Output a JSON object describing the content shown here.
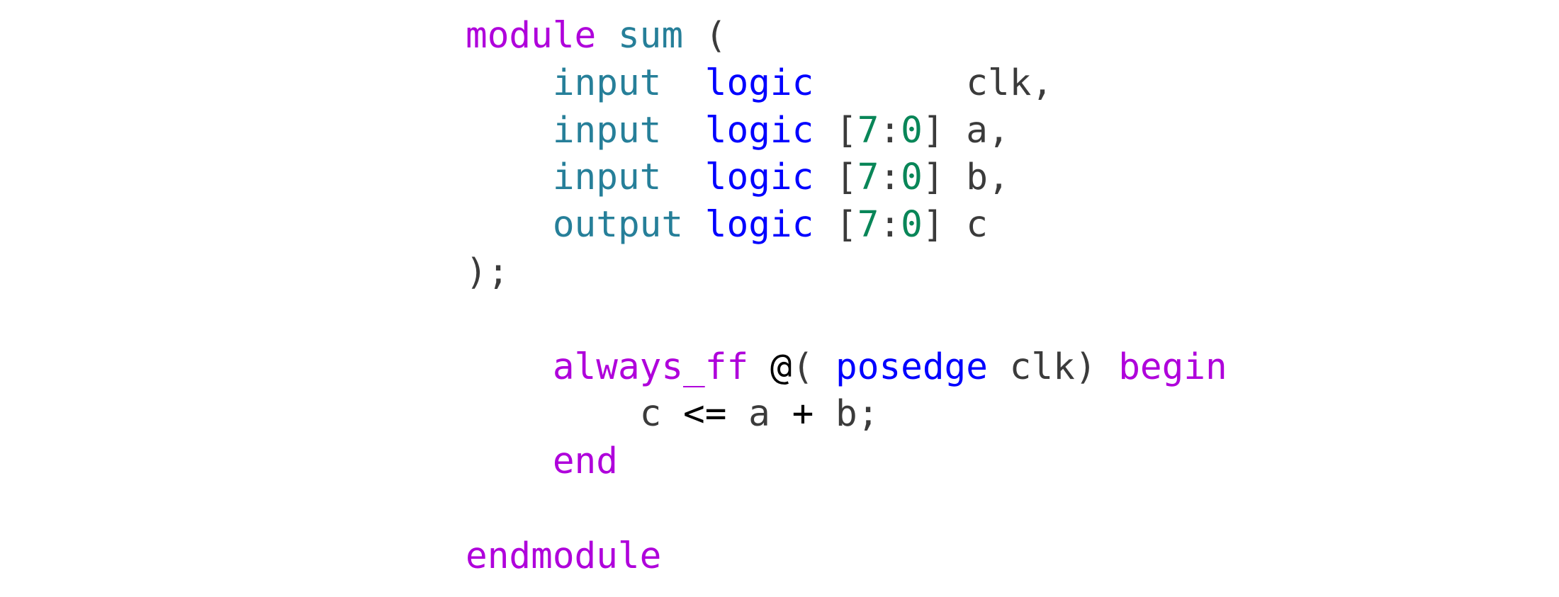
{
  "colors": {
    "background": "#ffffff",
    "control_keyword": "#af00db",
    "type_keyword": "#0000ff",
    "port_direction_and_module_name": "#267f99",
    "number": "#098658",
    "default_text": "#3b3b3b",
    "operator": "#000000"
  },
  "code": {
    "lines": [
      {
        "tokens": [
          {
            "text": "module",
            "kind": "control_keyword"
          },
          {
            "text": " ",
            "kind": "plain"
          },
          {
            "text": "sum",
            "kind": "module_name"
          },
          {
            "text": " (",
            "kind": "plain"
          }
        ]
      },
      {
        "tokens": [
          {
            "text": "    ",
            "kind": "plain"
          },
          {
            "text": "input",
            "kind": "port_direction"
          },
          {
            "text": "  ",
            "kind": "plain"
          },
          {
            "text": "logic",
            "kind": "type_keyword"
          },
          {
            "text": "       clk,",
            "kind": "plain"
          }
        ]
      },
      {
        "tokens": [
          {
            "text": "    ",
            "kind": "plain"
          },
          {
            "text": "input",
            "kind": "port_direction"
          },
          {
            "text": "  ",
            "kind": "plain"
          },
          {
            "text": "logic",
            "kind": "type_keyword"
          },
          {
            "text": " [",
            "kind": "plain"
          },
          {
            "text": "7",
            "kind": "number"
          },
          {
            "text": ":",
            "kind": "plain"
          },
          {
            "text": "0",
            "kind": "number"
          },
          {
            "text": "] a,",
            "kind": "plain"
          }
        ]
      },
      {
        "tokens": [
          {
            "text": "    ",
            "kind": "plain"
          },
          {
            "text": "input",
            "kind": "port_direction"
          },
          {
            "text": "  ",
            "kind": "plain"
          },
          {
            "text": "logic",
            "kind": "type_keyword"
          },
          {
            "text": " [",
            "kind": "plain"
          },
          {
            "text": "7",
            "kind": "number"
          },
          {
            "text": ":",
            "kind": "plain"
          },
          {
            "text": "0",
            "kind": "number"
          },
          {
            "text": "] b,",
            "kind": "plain"
          }
        ]
      },
      {
        "tokens": [
          {
            "text": "    ",
            "kind": "plain"
          },
          {
            "text": "output",
            "kind": "port_direction"
          },
          {
            "text": " ",
            "kind": "plain"
          },
          {
            "text": "logic",
            "kind": "type_keyword"
          },
          {
            "text": " [",
            "kind": "plain"
          },
          {
            "text": "7",
            "kind": "number"
          },
          {
            "text": ":",
            "kind": "plain"
          },
          {
            "text": "0",
            "kind": "number"
          },
          {
            "text": "] c",
            "kind": "plain"
          }
        ]
      },
      {
        "tokens": [
          {
            "text": ");",
            "kind": "plain"
          }
        ]
      },
      {
        "tokens": []
      },
      {
        "tokens": [
          {
            "text": "    ",
            "kind": "plain"
          },
          {
            "text": "always_ff",
            "kind": "control_keyword"
          },
          {
            "text": " ",
            "kind": "plain"
          },
          {
            "text": "@",
            "kind": "operator"
          },
          {
            "text": "( ",
            "kind": "plain"
          },
          {
            "text": "posedge",
            "kind": "type_keyword"
          },
          {
            "text": " clk) ",
            "kind": "plain"
          },
          {
            "text": "begin",
            "kind": "control_keyword"
          }
        ]
      },
      {
        "tokens": [
          {
            "text": "        c ",
            "kind": "plain"
          },
          {
            "text": "<=",
            "kind": "operator"
          },
          {
            "text": " a ",
            "kind": "plain"
          },
          {
            "text": "+",
            "kind": "operator"
          },
          {
            "text": " b;",
            "kind": "plain"
          }
        ]
      },
      {
        "tokens": [
          {
            "text": "    ",
            "kind": "plain"
          },
          {
            "text": "end",
            "kind": "control_keyword"
          }
        ]
      },
      {
        "tokens": []
      },
      {
        "tokens": [
          {
            "text": "endmodule",
            "kind": "control_keyword"
          }
        ]
      }
    ]
  }
}
